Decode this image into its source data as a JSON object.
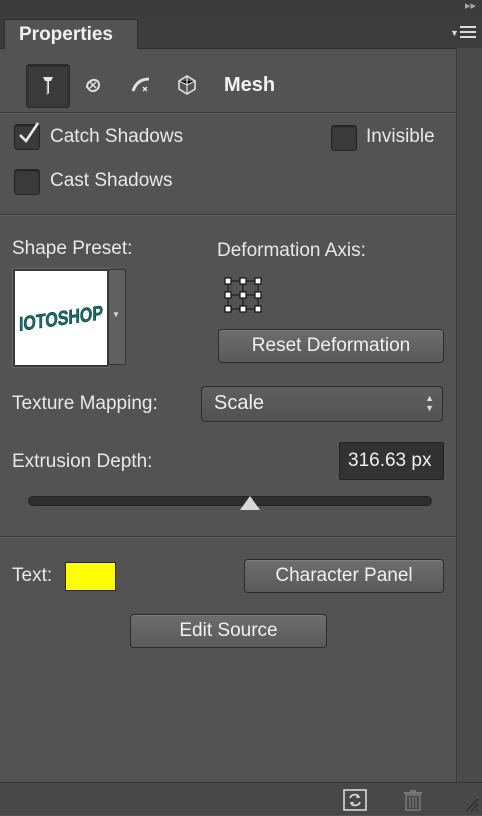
{
  "panel": {
    "tab_title": "Properties",
    "collapse_glyph": "▸▸"
  },
  "toolbar": {
    "mode_label": "Mesh",
    "icons": [
      "mesh-mode-icon",
      "deform-mode-icon",
      "cap-mode-icon",
      "coordinates-mode-icon"
    ]
  },
  "options": {
    "catch_shadows_label": "Catch Shadows",
    "catch_shadows_checked": true,
    "invisible_label": "Invisible",
    "invisible_checked": false,
    "cast_shadows_label": "Cast Shadows",
    "cast_shadows_checked": false
  },
  "shape": {
    "preset_label": "Shape Preset:",
    "preset_thumbnail_text": "IOTOSHOP",
    "deformation_axis_label": "Deformation Axis:",
    "reset_button": "Reset Deformation"
  },
  "texture": {
    "label": "Texture Mapping:",
    "value": "Scale"
  },
  "extrusion": {
    "label": "Extrusion Depth:",
    "value": "316.63 px",
    "slider_fraction": 0.55
  },
  "text_section": {
    "label": "Text:",
    "color": "#ffff00",
    "character_panel_button": "Character Panel",
    "edit_source_button": "Edit Source"
  },
  "footer": {
    "icons": [
      "render-toggle-icon",
      "trash-icon",
      "resize-grip-icon"
    ]
  },
  "colors": {
    "panel_bg": "#535353",
    "text_color": "#ffff00",
    "thumbnail_text": "#1a6b6b"
  }
}
